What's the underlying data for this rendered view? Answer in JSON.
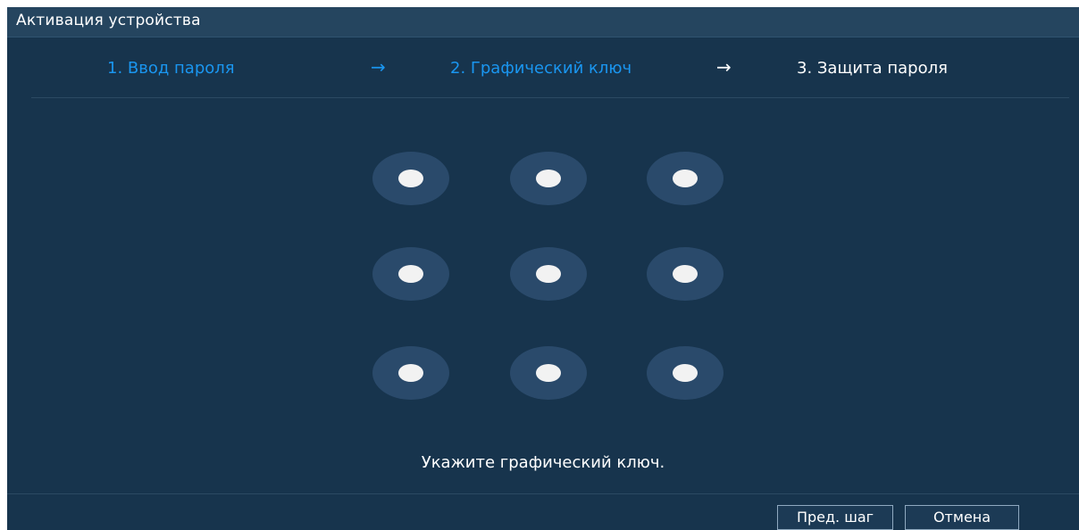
{
  "window": {
    "title": "Активация устройства"
  },
  "steps": [
    {
      "label": "1.  Ввод пароля",
      "state": "done"
    },
    {
      "label": "2.  Графический ключ",
      "state": "done"
    },
    {
      "label": "3.  Защита пароля",
      "state": "current"
    }
  ],
  "arrows": [
    "→",
    "→"
  ],
  "pattern": {
    "rows": 3,
    "cols": 3,
    "node_count": 9,
    "hint": "Укажите графический ключ."
  },
  "buttons": {
    "prev_label": "Пред. шаг",
    "cancel_label": "Отмена"
  },
  "colors": {
    "background": "#17344d",
    "titlebar": "#25455f",
    "accent": "#1a96f0",
    "node_ring": "#2a4a6b",
    "node_dot": "#f2f2f2"
  }
}
